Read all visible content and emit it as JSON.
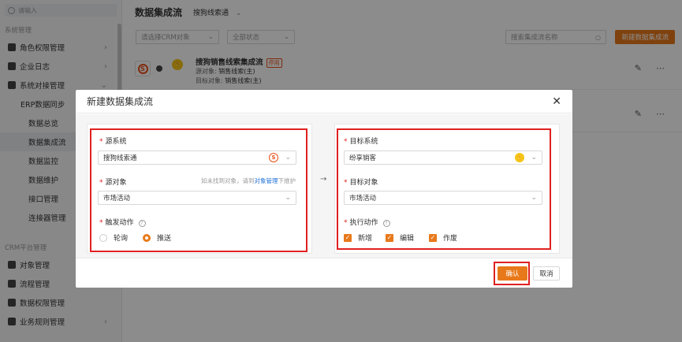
{
  "sidebar": {
    "search_placeholder": "请输入",
    "group1": "系统管理",
    "items1": [
      {
        "label": "角色权限管理",
        "has_chevron": true
      },
      {
        "label": "企业日志",
        "has_chevron": true
      },
      {
        "label": "系统对接管理",
        "has_chevron": true
      }
    ],
    "erp_group": "ERP数据同步",
    "erp_items": [
      "数据总览",
      "数据集成流",
      "数据监控",
      "数据维护",
      "接口管理",
      "连接器管理"
    ],
    "group2": "CRM平台管理",
    "items2": [
      {
        "label": "对象管理"
      },
      {
        "label": "流程管理",
        "has_chevron": true
      },
      {
        "label": "数据权限管理"
      },
      {
        "label": "业务规则管理",
        "has_chevron": true
      }
    ]
  },
  "main": {
    "title": "数据集成流",
    "system_select": "搜狗线索通",
    "filter_crm": "请选择CRM对象",
    "filter_status": "全部状态",
    "search_placeholder": "搜索集成流名称",
    "new_button": "新建数据集成流",
    "row1": {
      "title": "搜狗销售线索集成流",
      "badge": "停用",
      "source_label": "源对象:",
      "source_value": "销售线索(主)",
      "target_label": "目标对象:",
      "target_value": "销售线索(主)"
    }
  },
  "modal": {
    "title": "新建数据集成流",
    "source_system_label": "源系统",
    "source_system_value": "搜狗线索通",
    "source_object_label": "源对象",
    "source_object_hint": "如未找到对象，请到",
    "source_object_link": "对象管理",
    "source_object_hint_tail": "下维护",
    "source_object_value": "市场活动",
    "trigger_label": "触发动作",
    "trigger_options": [
      "轮询",
      "推送"
    ],
    "trigger_selected": "推送",
    "target_system_label": "目标系统",
    "target_system_value": "纷享销客",
    "target_object_label": "目标对象",
    "target_object_value": "市场活动",
    "action_label": "执行动作",
    "actions": [
      "新增",
      "编辑",
      "作废"
    ],
    "confirm": "确认",
    "cancel": "取消"
  },
  "colors": {
    "accent": "#e8791a",
    "highlight": "#e02020",
    "link": "#1e6fd9"
  }
}
